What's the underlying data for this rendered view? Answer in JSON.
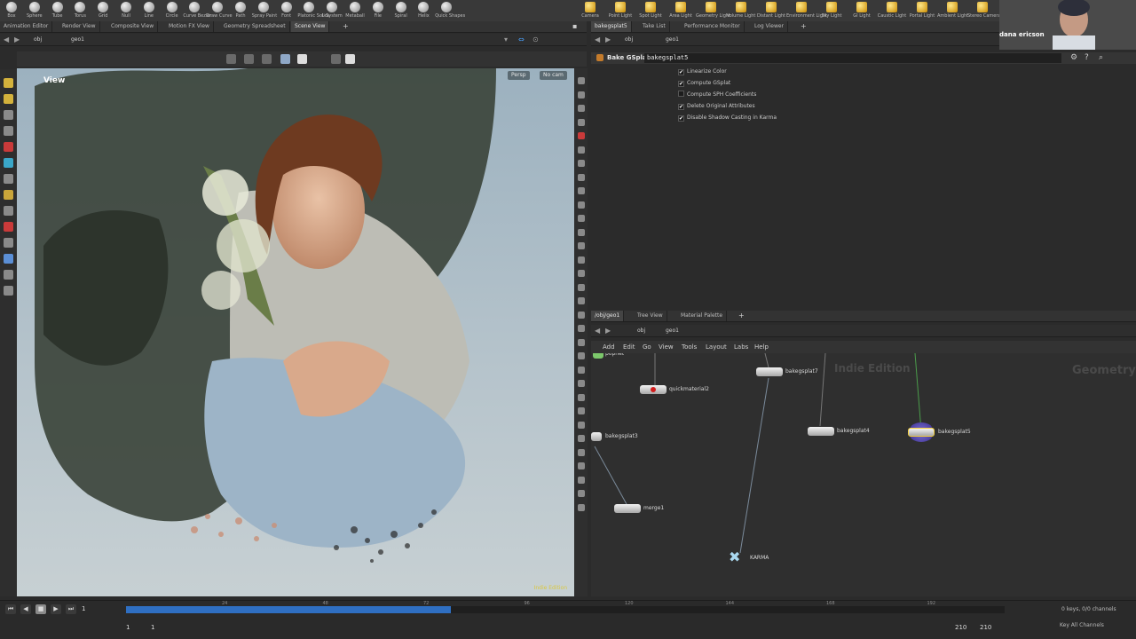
{
  "shelf": {
    "left_tools": [
      "Box",
      "Sphere",
      "Tube",
      "Torus",
      "Grid",
      "Null",
      "Line",
      "Circle",
      "Curve Bezier",
      "Draw Curve",
      "Path",
      "Spray Paint",
      "Font",
      "Platonic Solids",
      "L-System",
      "Metaball",
      "File",
      "Spiral",
      "Helix",
      "Quick Shapes"
    ],
    "right_tools": [
      "Camera",
      "Point Light",
      "Spot Light",
      "Area Light",
      "Geometry Light",
      "Volume Light",
      "Distant Light",
      "Environment Light",
      "Sky Light",
      "GI Light",
      "Caustic Light",
      "Portal Light",
      "Ambient Light",
      "Stereo Camera"
    ]
  },
  "left_tabs": [
    "Animation Editor",
    "Render View",
    "Composite View",
    "Motion FX View",
    "Geometry Spreadsheet",
    "Scene View"
  ],
  "right_top_tabs": [
    "bakegsplat5",
    "Take List",
    "Performance Monitor",
    "Log Viewer"
  ],
  "path_left": {
    "obj": "obj",
    "geo": "geo1"
  },
  "path_right": {
    "obj": "obj",
    "geo": "geo1"
  },
  "viewport": {
    "title": "View",
    "persp": "Persp",
    "cam": "No cam",
    "edition": "Indie Edition"
  },
  "params": {
    "node_type": "Bake GSplat",
    "node_name": "bakegsplat5",
    "toggles": [
      {
        "label": "Linearize Color",
        "checked": true
      },
      {
        "label": "Compute GSplat",
        "checked": true
      },
      {
        "label": "Compute SPH Coefficients",
        "checked": false
      },
      {
        "label": "Delete Original Attributes",
        "checked": true
      },
      {
        "label": "Disable Shadow Casting in Karma",
        "checked": true
      }
    ]
  },
  "net_tabs": [
    "/obj/geo1",
    "Tree View",
    "Material Palette"
  ],
  "net_path": {
    "obj": "obj",
    "geo": "geo1"
  },
  "net_menu": [
    "Add",
    "Edit",
    "Go",
    "View",
    "Tools",
    "Layout",
    "Labs",
    "Help"
  ],
  "net_watermark": "Indie Edition",
  "net_context": "Geometry",
  "nodes": {
    "popnet": "popnet",
    "quickmaterial2": "quickmaterial2",
    "bakegsplat7": "bakegsplat7",
    "bakegsplat3": "bakegsplat3",
    "bakegsplat4": "bakegsplat4",
    "bakegsplat5": "bakegsplat5",
    "merge1": "merge1",
    "karma": "KARMA"
  },
  "timeline": {
    "current_frame": "1",
    "ticks": [
      "24",
      "48",
      "72",
      "96",
      "120",
      "144",
      "168",
      "192"
    ],
    "range_start": "1",
    "range_start2": "1",
    "range_end": "210",
    "range_end2": "210",
    "keys_label": "0 keys, 0/0 channels",
    "key_all": "Key All Channels",
    "progress_fraction": 0.37
  },
  "webcam": {
    "name": "dana ericson"
  }
}
